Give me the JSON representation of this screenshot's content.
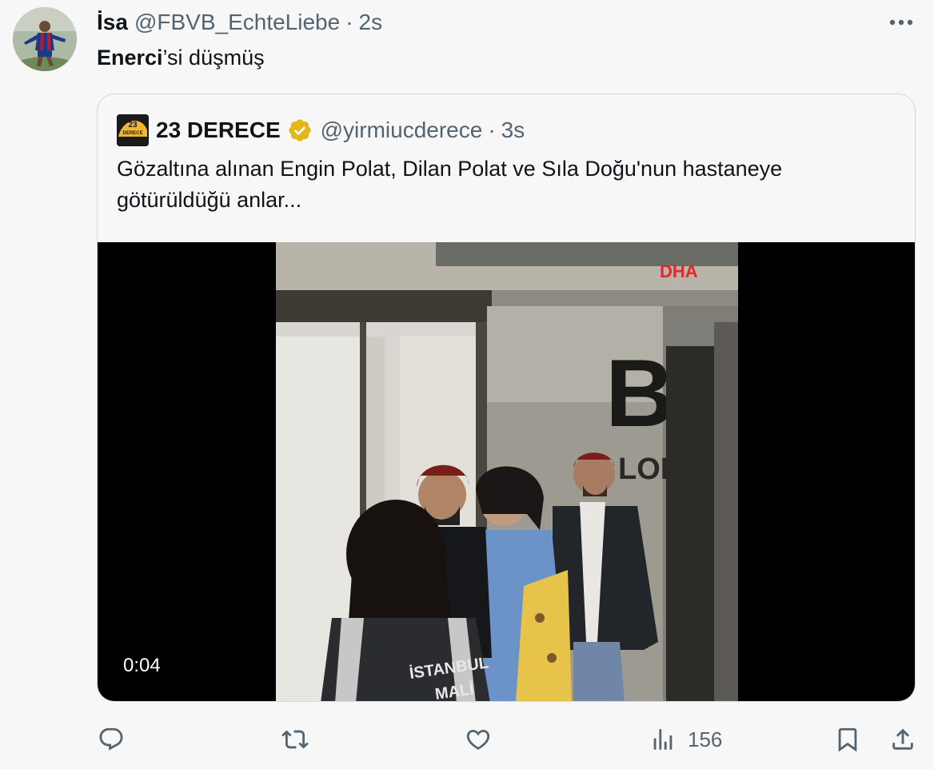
{
  "tweet": {
    "display_name": "İsa",
    "handle": "@FBVB_EchteLiebe",
    "separator": "·",
    "time": "2s",
    "text_bold": "Enerci",
    "text_rest": "’si düşmüş"
  },
  "quote": {
    "display_name": "23 DERECE",
    "handle": "@yirmiucderece",
    "separator": "·",
    "time": "3s",
    "text": "Gözaltına alınan Engin Polat, Dilan Polat ve Sıla Doğu'nun hastaneye götürüldüğü anlar...",
    "avatar_text_top": "23",
    "avatar_text_bottom": "DERECE",
    "video": {
      "duration": "0:04",
      "watermark": "DHA",
      "sign_letter": "B",
      "sign_text": "LOK",
      "vest_text_1": "İSTANBUL",
      "vest_text_2": "MALİ"
    }
  },
  "actions": {
    "views_count": "156"
  },
  "colors": {
    "text_primary": "#0f1419",
    "text_secondary": "#536471",
    "border": "#cfd9de",
    "background": "#f7f7f7",
    "verified_gold": "#e2b719",
    "watermark_red": "#e4262c"
  },
  "icons": {
    "more": "more-horizontal-icon",
    "verified": "verified-gold-badge-icon",
    "reply": "reply-icon",
    "retweet": "retweet-icon",
    "like": "heart-icon",
    "views": "views-bar-chart-icon",
    "bookmark": "bookmark-icon",
    "share": "share-icon"
  }
}
